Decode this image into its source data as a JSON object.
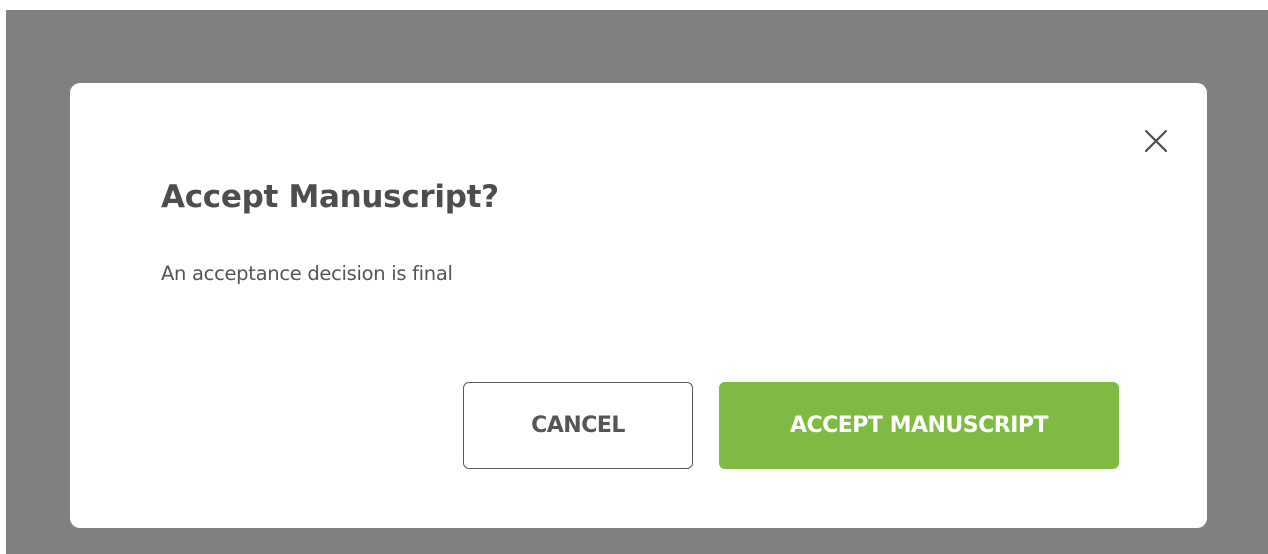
{
  "dialog": {
    "title": "Accept Manuscript?",
    "message": "An acceptance decision is final",
    "close_icon": "close-icon",
    "cancel_label": "CANCEL",
    "confirm_label": "ACCEPT MANUSCRIPT"
  },
  "colors": {
    "overlay": "#808080",
    "dialog_background": "#ffffff",
    "title_text": "#4d4d4d",
    "body_text": "#555555",
    "cancel_border": "#5a5a5a",
    "confirm_background": "#7fbb42",
    "confirm_text": "#ffffff"
  }
}
